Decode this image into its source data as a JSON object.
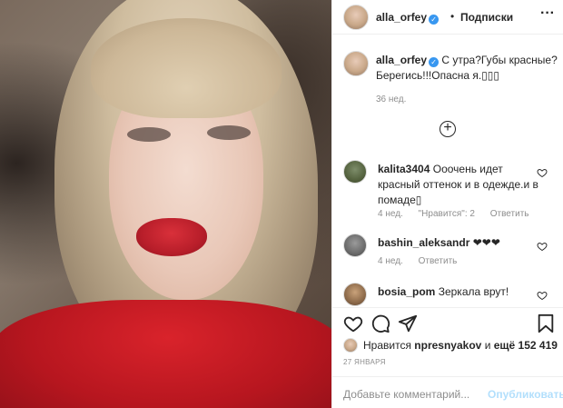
{
  "photo": {
    "alt_semantic": "portrait-photo"
  },
  "header": {
    "username": "alla_orfey",
    "verified_mark": "✓",
    "separator": "•",
    "follow_label": "Подписки",
    "more_label": "···"
  },
  "caption": {
    "username": "alla_orfey",
    "verified_mark": "✓",
    "text": "С утра?Губы красные? Берегись!!!Опасна я.▯▯▯",
    "time": "36 нед."
  },
  "load_more": {
    "label": "+"
  },
  "comments": [
    {
      "username": "kalita3404",
      "text": "Ооочень идет красный оттенок и в одежде.и в помаде▯",
      "time": "4 нед.",
      "likes": "\"Нравится\": 2",
      "reply": "Ответить"
    },
    {
      "username": "bashin_aleksandr",
      "text": "❤❤❤",
      "time": "4 нед.",
      "reply": "Ответить"
    },
    {
      "username": "bosia_pom",
      "text": "Зеркала врут!"
    }
  ],
  "likes": {
    "prefix": "Нравится",
    "user": "npresnyakov",
    "middle": "и",
    "count_label": "ещё 152 419"
  },
  "date": "27 ЯНВАРЯ",
  "add_comment": {
    "placeholder": "Добавьте комментарий...",
    "publish_label": "Опубликовать"
  },
  "icons": [
    "heart-icon",
    "comment-icon",
    "share-icon",
    "bookmark-icon"
  ]
}
